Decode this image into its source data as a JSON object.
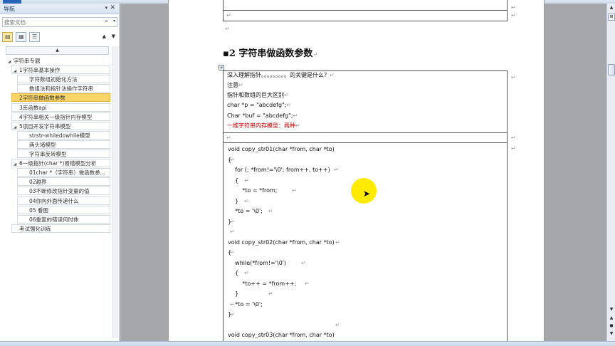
{
  "nav": {
    "title": "导航",
    "pin": "▾",
    "close": "✕",
    "search_placeholder": "搜索文档",
    "search_icon": "search-icon",
    "views": [
      "headings-view",
      "pages-view",
      "results-view"
    ],
    "prev": "▲",
    "next": "▼",
    "scroll_up": "▲",
    "items": [
      {
        "label": "字符串专题",
        "level": 0,
        "expander": "◢"
      },
      {
        "label": "1字符串基本操作",
        "level": 1,
        "expander": "◢"
      },
      {
        "label": "字符数组初始化方法",
        "level": 2,
        "expander": ""
      },
      {
        "label": "数组法和指针法操作字符串",
        "level": 2,
        "expander": ""
      },
      {
        "label": "2字符串做函数参数",
        "level": 1,
        "expander": "",
        "selected": true
      },
      {
        "label": "3库函数api",
        "level": 1,
        "expander": ""
      },
      {
        "label": "4字符串相关一级指针内存模型",
        "level": 1,
        "expander": ""
      },
      {
        "label": "5项目开发字符串模型",
        "level": 1,
        "expander": "◢"
      },
      {
        "label": "strstr-whiledowhile模型",
        "level": 2,
        "expander": ""
      },
      {
        "label": "两头堵模型",
        "level": 2,
        "expander": ""
      },
      {
        "label": "字符串反转模型",
        "level": 2,
        "expander": ""
      },
      {
        "label": "6一级指针(char *)易错模型分析",
        "level": 1,
        "expander": "◢"
      },
      {
        "label": "01char *（字符串）做函数参...",
        "level": 2,
        "expander": ""
      },
      {
        "label": "02越界",
        "level": 2,
        "expander": ""
      },
      {
        "label": "03不断修改指针变量的值",
        "level": 2,
        "expander": ""
      },
      {
        "label": "04你向外面传递什么",
        "level": 2,
        "expander": ""
      },
      {
        "label": "05 看图",
        "level": 2,
        "expander": ""
      },
      {
        "label": "06重复的错误何时休",
        "level": 2,
        "expander": ""
      },
      {
        "label": "考试强化训练",
        "level": 1,
        "expander": ""
      }
    ]
  },
  "document": {
    "heading_bullet": "▪",
    "heading": "2 字符串做函数参数",
    "pilcrow": "↵",
    "return_mark": "↵",
    "table_anchor": "+",
    "box1": {
      "lines": [
        "深入理解指针。。。。。。。。。的关键是什么？",
        "注意",
        "指针和数组的巨大区别",
        "char *p = \"abcdefg\";",
        "Char *buf = \"abcdefg\";",
        "一维字符串内存模型：两种"
      ]
    },
    "code": [
      "void copy_str01(char *from, char *to)",
      "{",
      "    for (; *from!='\\0'; from++, to++)",
      "    {",
      "        *to = *from;",
      "    }",
      "    *to = '\\0';",
      "}",
      "",
      "void copy_str02(char *from, char *to)",
      "{",
      "    while(*from!='\\0')",
      "    {",
      "        *to++ = *from++;",
      "    }",
      "    *to = '\\0';",
      "}",
      "",
      "void copy_str03(char *from, char *to)"
    ]
  },
  "scrollbar": {
    "up": "▲",
    "ruler": "⊞",
    "down": "▼",
    "prev_page": "▲",
    "browse": "●",
    "next_page": "▼"
  }
}
